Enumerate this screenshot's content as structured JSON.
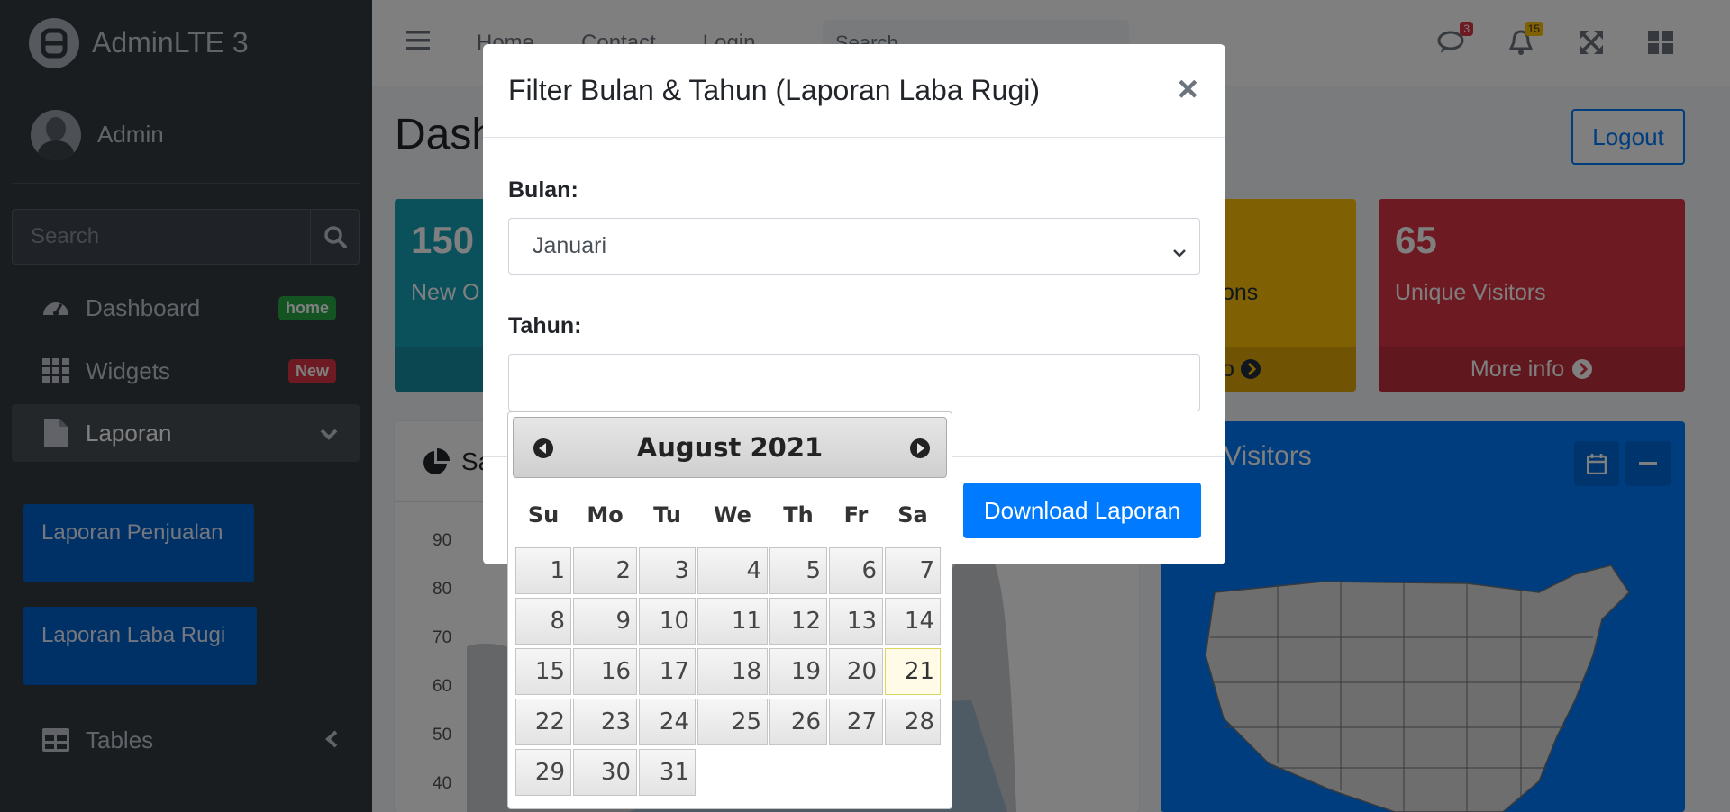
{
  "sidebar": {
    "brand": "AdminLTE 3",
    "user": "Admin",
    "search_placeholder": "Search",
    "items": [
      {
        "label": "Dashboard",
        "badge": "home"
      },
      {
        "label": "Widgets",
        "badge": "New"
      },
      {
        "label": "Laporan"
      },
      {
        "label": "Tables"
      }
    ],
    "sub_items": [
      "Laporan Penjualan",
      "Laporan Laba Rugi"
    ]
  },
  "navbar": {
    "links": [
      "Home",
      "Contact",
      "Login"
    ],
    "search_placeholder": "Search",
    "messages_count": "3",
    "notifications_count": "15"
  },
  "page": {
    "title": "Dash",
    "logout": "Logout",
    "boxes": [
      {
        "value": "150",
        "label": "New O",
        "footer": ""
      },
      {
        "value": "",
        "label": "ons",
        "footer": "o"
      },
      {
        "value": "65",
        "label": "Unique Visitors",
        "footer": "More info"
      }
    ],
    "sales_title": "Sa",
    "visitors_title": "Visitors",
    "yaxis": [
      "90",
      "80",
      "70",
      "60",
      "50",
      "40"
    ]
  },
  "modal": {
    "title": "Filter Bulan & Tahun (Laporan Laba Rugi)",
    "close": "×",
    "bulan_label": "Bulan:",
    "bulan_value": "Januari",
    "tahun_label": "Tahun:",
    "tahun_value": "",
    "download": "Download Laporan"
  },
  "datepicker": {
    "month_year": "August 2021",
    "weekdays": [
      "Su",
      "Mo",
      "Tu",
      "We",
      "Th",
      "Fr",
      "Sa"
    ],
    "today": 21,
    "days": [
      1,
      2,
      3,
      4,
      5,
      6,
      7,
      8,
      9,
      10,
      11,
      12,
      13,
      14,
      15,
      16,
      17,
      18,
      19,
      20,
      21,
      22,
      23,
      24,
      25,
      26,
      27,
      28,
      29,
      30,
      31
    ]
  },
  "colors": {
    "sidebar": "#343a40",
    "primary": "#007bff",
    "info": "#17a2b8",
    "warning": "#ffc107",
    "danger": "#dc3545",
    "success": "#28a745"
  }
}
